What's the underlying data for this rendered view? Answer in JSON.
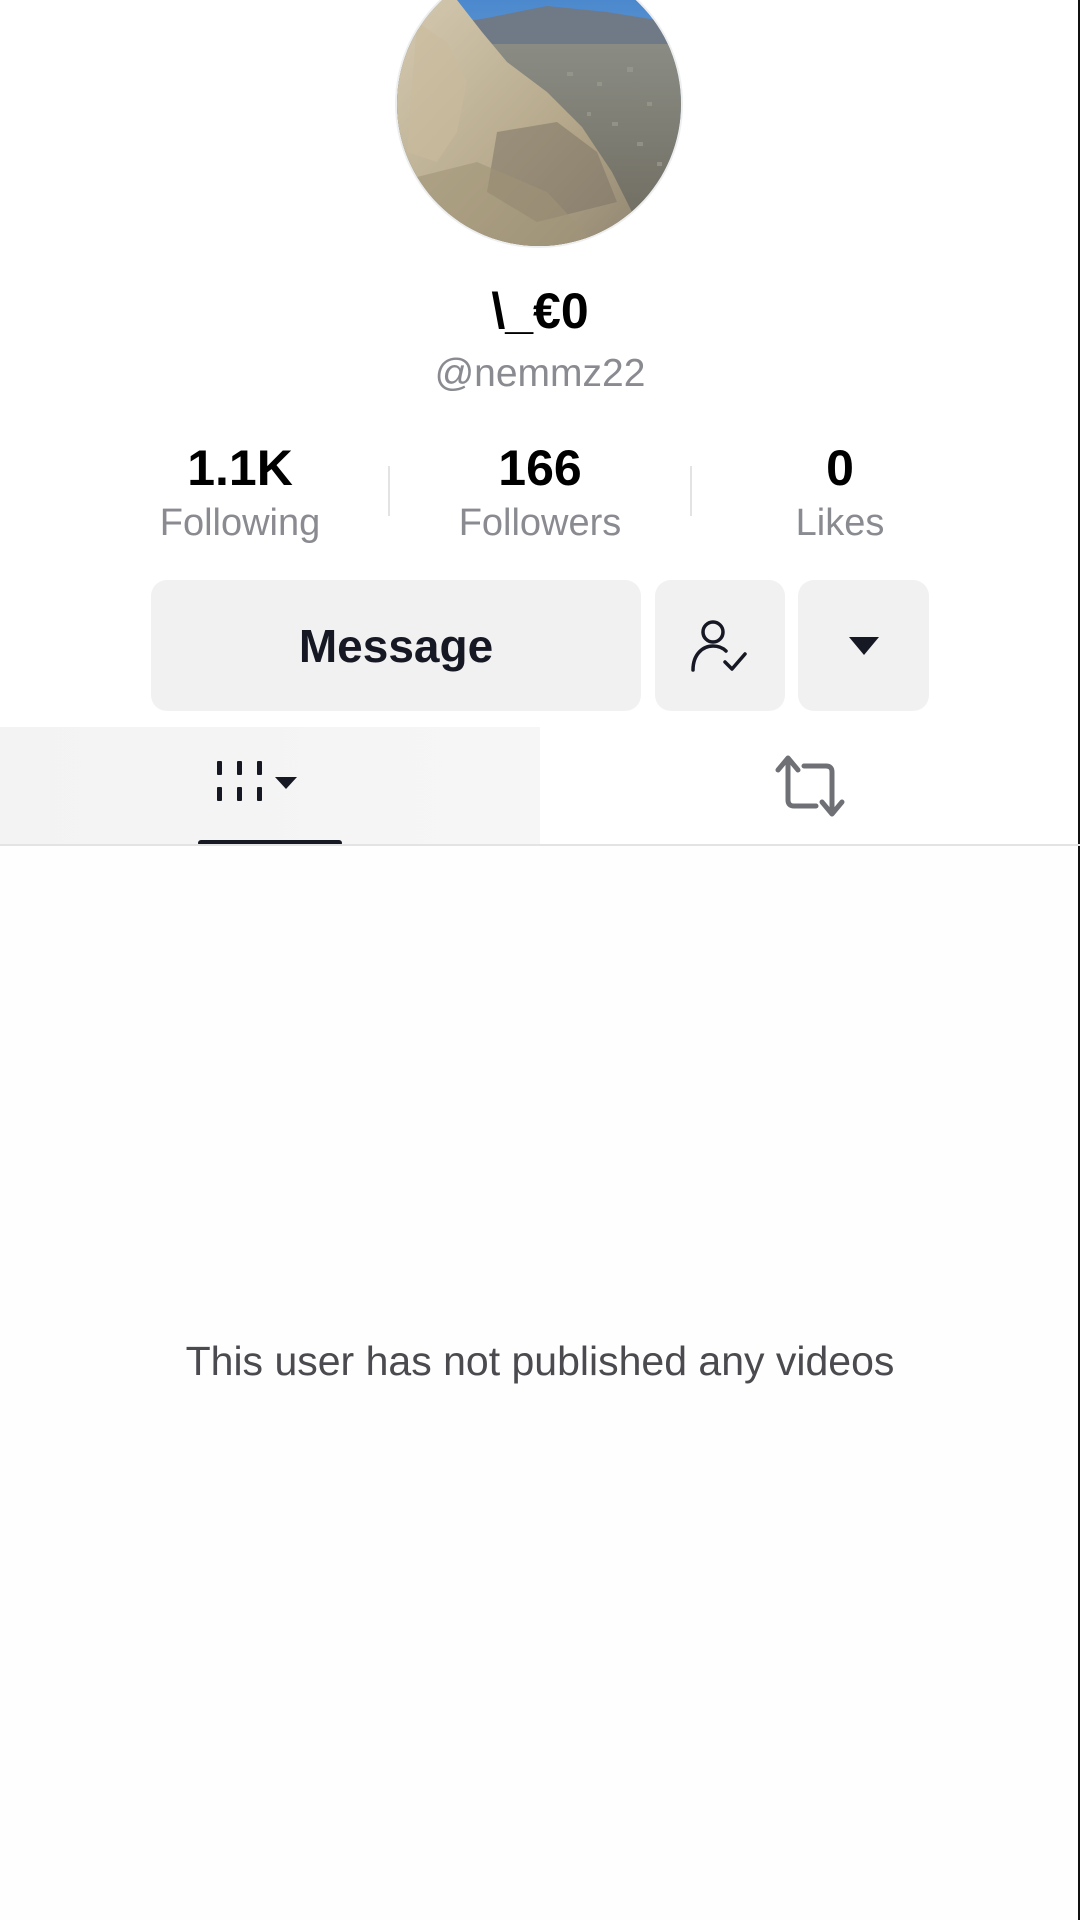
{
  "profile": {
    "display_name": "\\_€0",
    "username": "@nemmz22",
    "avatar_icon": "avatar-photo-mountain"
  },
  "stats": {
    "following": {
      "value": "1.1K",
      "label": "Following"
    },
    "followers": {
      "value": "166",
      "label": "Followers"
    },
    "likes": {
      "value": "0",
      "label": "Likes"
    }
  },
  "actions": {
    "message_label": "Message",
    "follow_icon": "user-check-icon",
    "more_icon": "caret-down-icon"
  },
  "tabs": [
    {
      "name": "videos",
      "icon": "grid-icon",
      "selected": true
    },
    {
      "name": "reposts",
      "icon": "repost-icon",
      "selected": false
    }
  ],
  "content": {
    "empty_message": "This user has not published any videos"
  }
}
